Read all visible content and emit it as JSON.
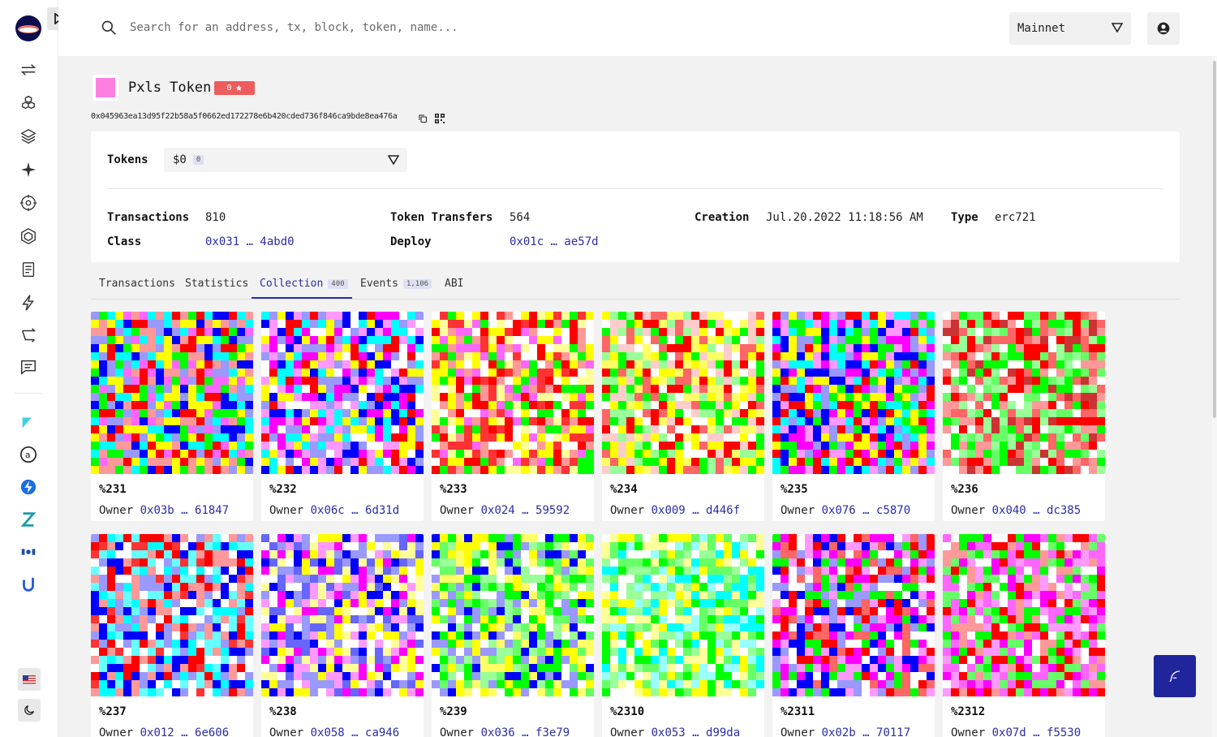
{
  "header": {
    "search_placeholder": "Search for an address, tx, block, token, name...",
    "network": "Mainnet"
  },
  "token": {
    "name": "Pxls Token",
    "stars": "0",
    "address": "0x045963ea13d95f22b58a5f0662ed172278e6b420cded736f846ca9bde8ea476a",
    "avatar_color": "#ff7fe0"
  },
  "info": {
    "tokens_label": "Tokens",
    "tokens_value": "$0",
    "tokens_count": "0",
    "transactions_label": "Transactions",
    "transactions_value": "810",
    "class_label": "Class",
    "class_value": "0x031 … 4abd0",
    "transfers_label": "Token Transfers",
    "transfers_value": "564",
    "deploy_label": "Deploy",
    "deploy_value": "0x01c … ae57d",
    "creation_label": "Creation",
    "creation_value": "Jul.20.2022 11:18:56 AM",
    "type_label": "Type",
    "type_value": "erc721"
  },
  "tabs": [
    {
      "label": "Transactions",
      "badge": ""
    },
    {
      "label": "Statistics",
      "badge": ""
    },
    {
      "label": "Collection",
      "badge": "400"
    },
    {
      "label": "Events",
      "badge": "1,106"
    },
    {
      "label": "ABI",
      "badge": ""
    }
  ],
  "owner_label": "Owner",
  "nfts": [
    {
      "id": "%231",
      "owner": "0x03b … 61847",
      "palette": [
        "#ffff00",
        "#ff66ff",
        "#00ffff",
        "#0000ff",
        "#ff0000",
        "#9999ff",
        "#ff9999",
        "#00ff00"
      ]
    },
    {
      "id": "%232",
      "owner": "0x06c … 6d31d",
      "palette": [
        "#00ffff",
        "#ff00ff",
        "#ffff00",
        "#9999ff",
        "#0000ff",
        "#ff0000",
        "#ff99ff",
        "#ffffff"
      ]
    },
    {
      "id": "%233",
      "owner": "0x024 … 59592",
      "palette": [
        "#ffff00",
        "#ff0000",
        "#00ff00",
        "#ff9999",
        "#ffffff",
        "#ff66ff",
        "#ffff99",
        "#ff3333"
      ]
    },
    {
      "id": "%234",
      "owner": "0x009 … d446f",
      "palette": [
        "#ffff00",
        "#ff0000",
        "#00ff00",
        "#99ff99",
        "#ffffff",
        "#ff6666",
        "#ffcccc",
        "#ffff66"
      ]
    },
    {
      "id": "%235",
      "owner": "0x076 … c5870",
      "palette": [
        "#ff00ff",
        "#ffff00",
        "#00ffff",
        "#ff0000",
        "#0000ff",
        "#00ff00",
        "#ff99ff",
        "#9999ff"
      ]
    },
    {
      "id": "%236",
      "owner": "0x040 … dc385",
      "palette": [
        "#ff0000",
        "#00ff00",
        "#ff6666",
        "#66ff66",
        "#ff9999",
        "#99ff99",
        "#cc3333",
        "#ffffff"
      ]
    },
    {
      "id": "%237",
      "owner": "0x012 … 6e606",
      "palette": [
        "#ff0000",
        "#00ffff",
        "#0000ff",
        "#9999ff",
        "#ff9999",
        "#ffffff",
        "#66ffff",
        "#ff3333"
      ]
    },
    {
      "id": "%238",
      "owner": "0x058 … ca946",
      "palette": [
        "#ffff00",
        "#ff00ff",
        "#0000ff",
        "#9999ff",
        "#ffffff",
        "#ff99ff",
        "#ffff99",
        "#6666ff"
      ]
    },
    {
      "id": "%239",
      "owner": "0x036 … f3e79",
      "palette": [
        "#ffff00",
        "#00ff00",
        "#0000ff",
        "#99ff99",
        "#9999ff",
        "#ffffff",
        "#ffff66",
        "#66ff66"
      ]
    },
    {
      "id": "%2310",
      "owner": "0x053 … d99da",
      "palette": [
        "#00ffff",
        "#ffff00",
        "#00ff00",
        "#99ffff",
        "#ffff99",
        "#99ff99",
        "#ffffff",
        "#66ff66"
      ]
    },
    {
      "id": "%2311",
      "owner": "0x02b … 70117",
      "palette": [
        "#ff00ff",
        "#ff0000",
        "#00ff00",
        "#0000ff",
        "#ff99ff",
        "#ffffff",
        "#9999ff",
        "#ff6666"
      ]
    },
    {
      "id": "%2312",
      "owner": "0x07d … f5530",
      "palette": [
        "#ff00ff",
        "#00ff00",
        "#ff0000",
        "#ff99ff",
        "#ffffff",
        "#ff66ff",
        "#66ff66",
        "#ff9999"
      ]
    }
  ],
  "colors": {
    "accent": "#2a2ea5",
    "star_badge": "#ee5d5d",
    "feedback_button": "#20259c"
  },
  "icons": [
    "transactions-icon",
    "blocks-icon",
    "contracts-icon",
    "starknet-icon",
    "explore-icon",
    "nodes-icon",
    "docs-icon",
    "sparks-icon",
    "bridge-icon",
    "feedback-icon"
  ]
}
